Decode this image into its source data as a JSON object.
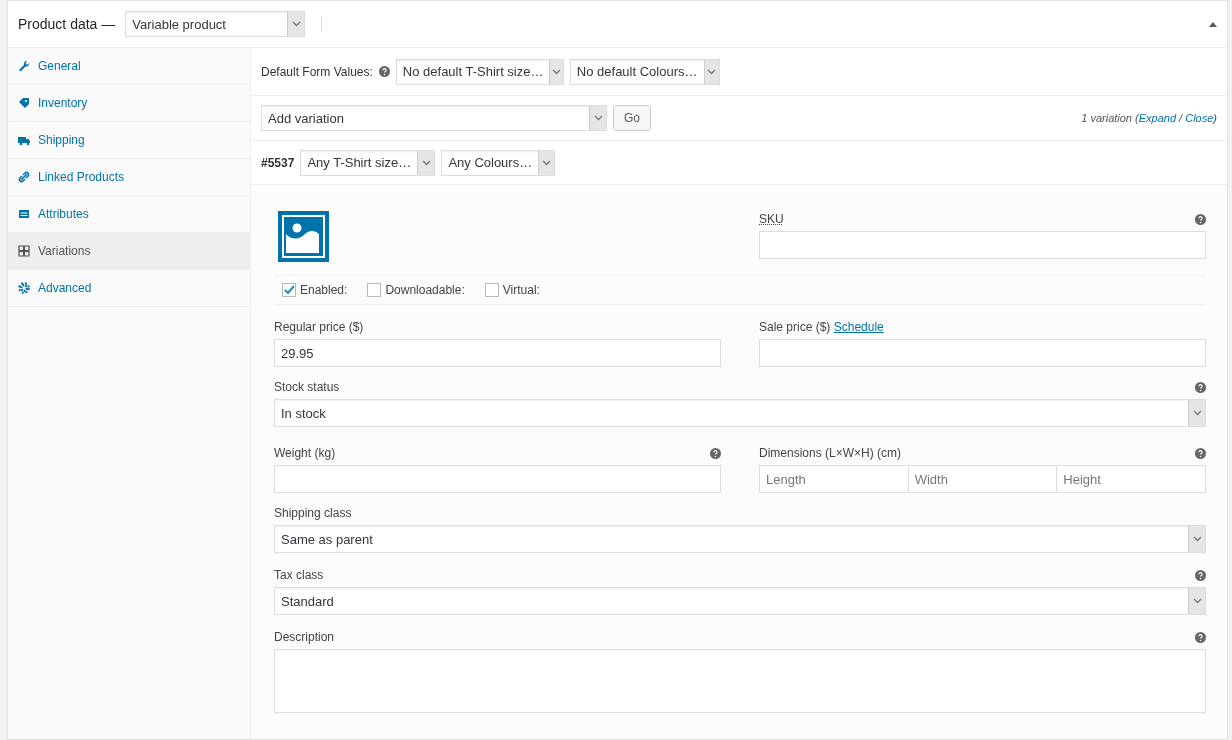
{
  "header": {
    "title": "Product data —",
    "product_type": "Variable product"
  },
  "tabs": [
    {
      "label": "General",
      "selected": false
    },
    {
      "label": "Inventory",
      "selected": false
    },
    {
      "label": "Shipping",
      "selected": false
    },
    {
      "label": "Linked Products",
      "selected": false
    },
    {
      "label": "Attributes",
      "selected": false
    },
    {
      "label": "Variations",
      "selected": true
    },
    {
      "label": "Advanced",
      "selected": false
    }
  ],
  "default_form": {
    "label": "Default Form Values:",
    "selects": [
      "No default T-Shirt size…",
      "No default Colours…"
    ]
  },
  "add_variation": {
    "select": "Add variation",
    "button": "Go",
    "summary_prefix": "1 variation (",
    "links": [
      "Expand",
      "Close"
    ],
    "separator": " / ",
    "summary_suffix": ")"
  },
  "variation": {
    "id": "#5537",
    "selects": [
      "Any T-Shirt size…",
      "Any Colours…"
    ],
    "sku": {
      "label": "SKU",
      "help": true
    },
    "checkboxes": [
      {
        "label": "Enabled:",
        "checked": true
      },
      {
        "label": "Downloadable:",
        "checked": false
      },
      {
        "label": "Virtual:",
        "checked": false
      }
    ],
    "regular_price": {
      "label": "Regular price ($)",
      "value": "29.95"
    },
    "sale_price": {
      "label": "Sale price ($)",
      "link": "Schedule"
    },
    "stock_status": {
      "label": "Stock status",
      "value": "In stock",
      "help": true
    },
    "weight": {
      "label": "Weight (kg)",
      "help": true
    },
    "dimensions": {
      "label": "Dimensions (L×W×H) (cm)",
      "placeholders": [
        "Length",
        "Width",
        "Height"
      ],
      "help": true
    },
    "shipping_class": {
      "label": "Shipping class",
      "value": "Same as parent",
      "help": false
    },
    "tax_class": {
      "label": "Tax class",
      "value": "Standard",
      "help": true
    },
    "description": {
      "label": "Description",
      "help": true
    }
  }
}
